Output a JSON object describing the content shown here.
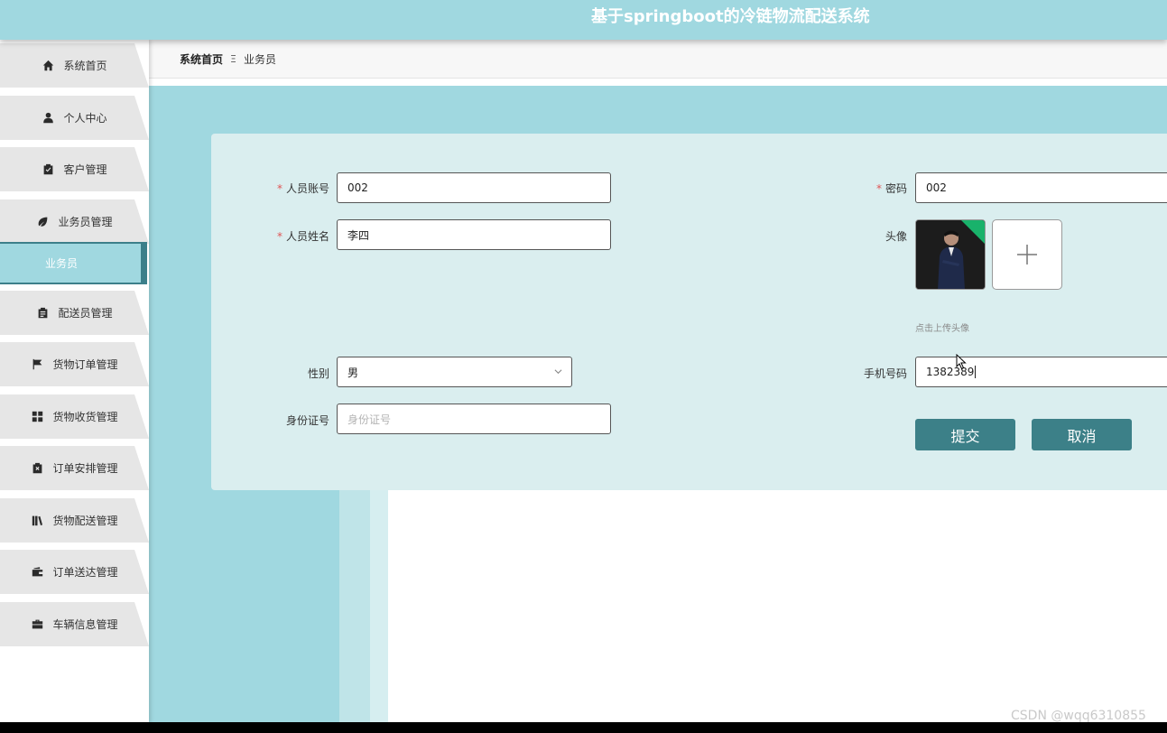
{
  "header": {
    "title": "基于springboot的冷链物流配送系统"
  },
  "sidebar": {
    "items": [
      {
        "label": "系统首页",
        "icon": "home-icon"
      },
      {
        "label": "个人中心",
        "icon": "user-icon"
      },
      {
        "label": "客户管理",
        "icon": "clipboard-check-icon"
      },
      {
        "label": "业务员管理",
        "icon": "leaf-icon"
      },
      {
        "label": "配送员管理",
        "icon": "clipboard-icon"
      },
      {
        "label": "货物订单管理",
        "icon": "flag-icon"
      },
      {
        "label": "货物收货管理",
        "icon": "grid-icon"
      },
      {
        "label": "订单安排管理",
        "icon": "clipboard-x-icon"
      },
      {
        "label": "货物配送管理",
        "icon": "books-icon"
      },
      {
        "label": "订单送达管理",
        "icon": "wallet-icon"
      },
      {
        "label": "车辆信息管理",
        "icon": "briefcase-icon"
      }
    ],
    "sub_item": {
      "label": "业务员"
    }
  },
  "breadcrumb": {
    "home": "系统首页",
    "separator": "Ξ",
    "current": "业务员"
  },
  "form": {
    "account": {
      "label": "人员账号",
      "value": "002"
    },
    "password": {
      "label": "密码",
      "value": "002"
    },
    "name": {
      "label": "人员姓名",
      "value": "李四"
    },
    "avatar": {
      "label": "头像",
      "hint": "点击上传头像"
    },
    "gender": {
      "label": "性别",
      "value": "男"
    },
    "phone": {
      "label": "手机号码",
      "value": "1382389"
    },
    "id_card": {
      "label": "身份证号",
      "placeholder": "身份证号"
    },
    "submit_label": "提交",
    "cancel_label": "取消"
  },
  "watermark": "CSDN @wqq6310855",
  "colors": {
    "accent": "#a0d8e0",
    "button": "#3c8088",
    "required": "#e05555"
  }
}
